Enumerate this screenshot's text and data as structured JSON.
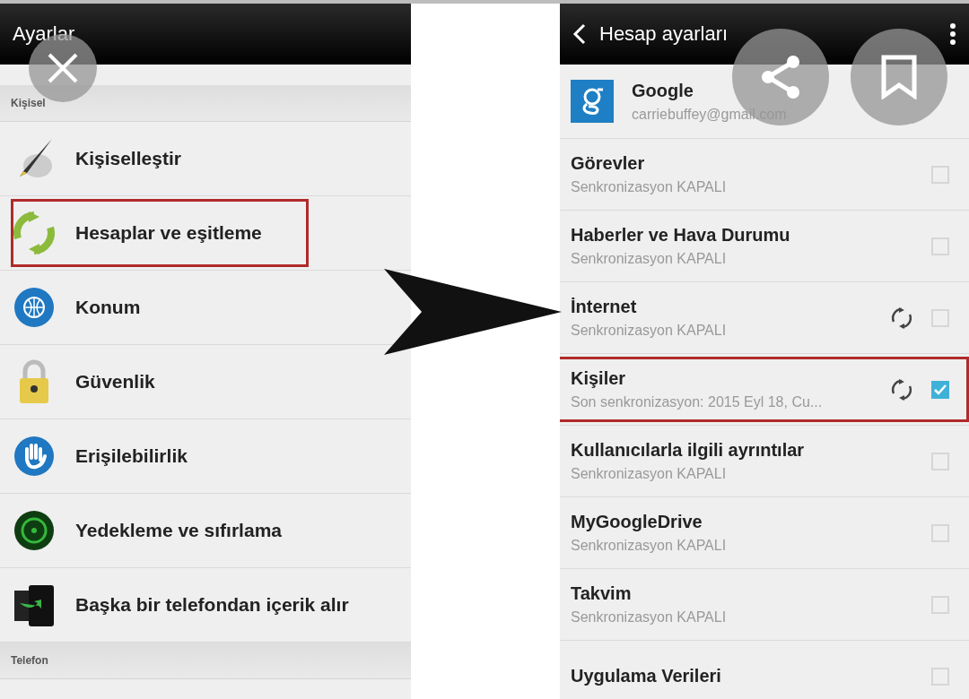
{
  "settings": {
    "title": "Ayarlar",
    "sections": [
      {
        "header": "Kişisel",
        "items": [
          {
            "label": "Kişiselleştir",
            "highlighted": false
          },
          {
            "label": "Hesaplar ve eşitleme",
            "highlighted": true
          },
          {
            "label": "Konum",
            "highlighted": false
          },
          {
            "label": "Güvenlik",
            "highlighted": false
          },
          {
            "label": "Erişilebilirlik",
            "highlighted": false
          },
          {
            "label": "Yedekleme ve sıfırlama",
            "highlighted": false
          },
          {
            "label": "Başka bir telefondan içerik alır",
            "highlighted": false
          }
        ]
      },
      {
        "header": "Telefon"
      }
    ]
  },
  "account_settings": {
    "title": "Hesap ayarları",
    "account": {
      "name": "Google",
      "email": "carriebuffey@gmail.com"
    },
    "items": [
      {
        "title": "Görevler",
        "status": "Senkronizasyon KAPALI",
        "sync_icon": false,
        "checked": false,
        "highlighted": false
      },
      {
        "title": "Haberler ve Hava Durumu",
        "status": "Senkronizasyon KAPALI",
        "sync_icon": false,
        "checked": false,
        "highlighted": false
      },
      {
        "title": "İnternet",
        "status": "Senkronizasyon KAPALI",
        "sync_icon": true,
        "checked": false,
        "highlighted": false
      },
      {
        "title": "Kişiler",
        "status": "Son senkronizasyon: 2015 Eyl 18, Cu...",
        "sync_icon": true,
        "checked": true,
        "highlighted": true
      },
      {
        "title": "Kullanıcılarla ilgili ayrıntılar",
        "status": "Senkronizasyon KAPALI",
        "sync_icon": false,
        "checked": false,
        "highlighted": false
      },
      {
        "title": "MyGoogleDrive",
        "status": "Senkronizasyon KAPALI",
        "sync_icon": false,
        "checked": false,
        "highlighted": false
      },
      {
        "title": "Takvim",
        "status": "Senkronizasyon KAPALI",
        "sync_icon": false,
        "checked": false,
        "highlighted": false
      },
      {
        "title": "Uygulama Verileri",
        "sync_icon": false,
        "checked": false,
        "highlighted": false
      }
    ]
  }
}
